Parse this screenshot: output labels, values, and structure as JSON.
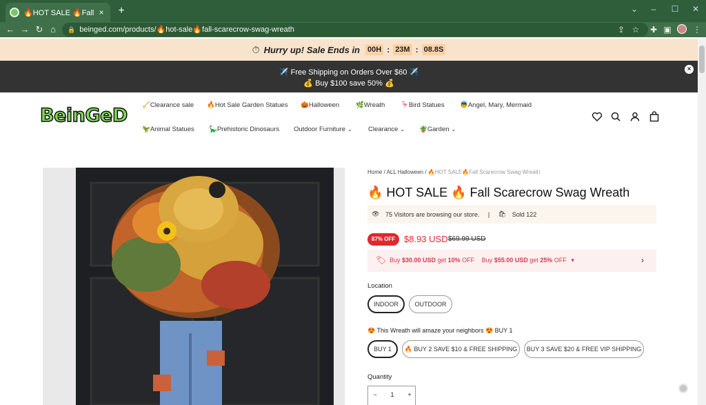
{
  "browser": {
    "tab_title": "🔥HOT SALE 🔥Fall Scarecrow S",
    "tab_close": "×",
    "new_tab": "+",
    "url": "beinged.com/products/🔥hot-sale🔥fall-scarecrow-swag-wreath",
    "window_controls": [
      "⌄",
      "–",
      "☐",
      "✕"
    ],
    "nav": {
      "back": "←",
      "forward": "→",
      "reload": "↻",
      "home": "⌂"
    },
    "toolbar_icons": [
      "⇪",
      "☆",
      "✚",
      "▣",
      "⋮"
    ]
  },
  "sale_timer": {
    "text": "Hurry up! Sale Ends in",
    "hours": "00H",
    "minutes": "23M",
    "seconds": "08.8S",
    "separator": ":"
  },
  "announcement": {
    "line1": "✈️ Free Shipping on Orders Over $60 ✈️",
    "line2": "💰 Buy $100 save 50% 💰",
    "close": "×"
  },
  "header": {
    "logo": "BeinGeD",
    "nav_row1": [
      "🧹Clearance sale",
      "🔥Hot Sale Garden Statues",
      "🎃Halloween",
      "🌿Wreath",
      "🦩Bird Statues",
      "👼Angel, Mary, Mermaid"
    ],
    "nav_row2": [
      "🦖Animal Statues",
      "🦕Prehistoric Dinosaurs",
      "Outdoor Furniture",
      "Clearance",
      "🪴Garden"
    ],
    "chevron": "⌄"
  },
  "product": {
    "breadcrumb_home": "Home",
    "breadcrumb_sep": "/",
    "breadcrumb_collection": "ALL Halloween",
    "breadcrumb_current": "🔥HOT SALE🔥Fall Scarecrow Swag Wreath",
    "title": "🔥 HOT SALE 🔥 Fall Scarecrow Swag Wreath",
    "visitors": "75 Visitors are browsing our store.",
    "sold": "Sold 122",
    "discount_badge": "87% OFF",
    "price": "$8.93 USD",
    "compare_price": "$69.99 USD",
    "offer1_prefix": "Buy",
    "offer1_amount": "$30.00 USD",
    "offer1_mid": "get",
    "offer1_pct": "10%",
    "offer1_suffix": "OFF",
    "offer2_prefix": "Buy",
    "offer2_amount": "$55.00 USD",
    "offer2_mid": "get",
    "offer2_pct": "25%",
    "offer2_suffix": "OFF",
    "location_label": "Location",
    "location_options": [
      "INDOOR",
      "OUTDOOR"
    ],
    "location_selected": "INDOOR",
    "bundle_label": "😍 This Wreath will amaze your neighbors 😍  BUY 1",
    "bundle_options": [
      "BUY 1",
      "🔥 BUY 2 SAVE $10 & FREE SHIPPING",
      "BUY 3 SAVE $20 & FREE VIP SHIPPING"
    ],
    "bundle_selected": "BUY 1",
    "quantity_label": "Quantity",
    "quantity_minus": "−",
    "quantity_value": "1",
    "quantity_plus": "+"
  },
  "colors": {
    "chrome": "#3f7049",
    "sale_bar": "#f8e3cc",
    "announcement_bar": "#333333",
    "accent_red": "#e0282e",
    "logo_green": "#7ed957"
  }
}
